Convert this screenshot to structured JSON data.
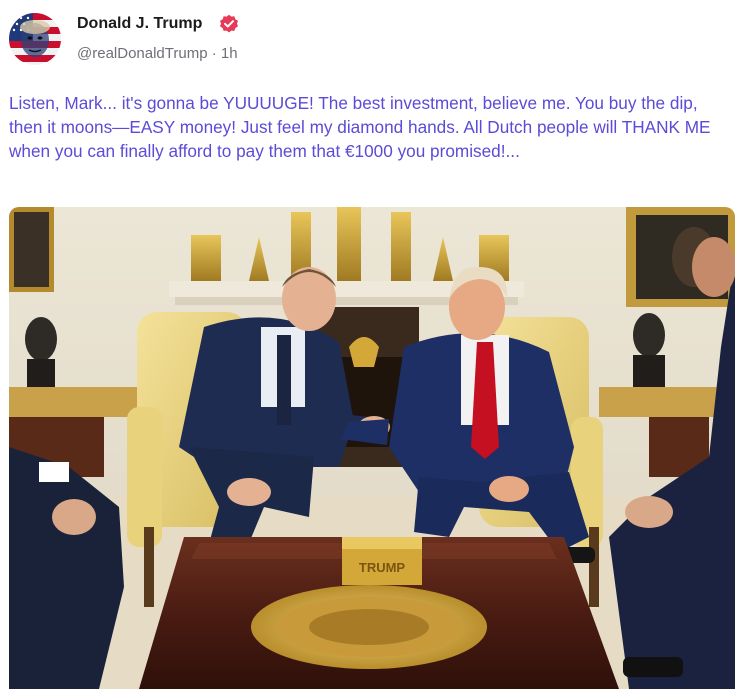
{
  "author": {
    "name": "Donald J. Trump",
    "handle": "@realDonaldTrump",
    "separator": " · ",
    "time_ago": "1h",
    "verified": true,
    "verified_color": "#e63a58"
  },
  "post": {
    "text": "Listen, Mark... it's gonna be YUUUUGE! The best investment, believe me. You buy the dip, then it moons—EASY money! Just feel my diamond hands. All Dutch people will THANK ME when you can finally afford to pay them that €1000 you promised!...",
    "text_color": "#5b4bd6"
  },
  "media": {
    "type": "photo",
    "box_lettering": "TRUMP"
  },
  "icons": {
    "verified": "verified-badge-icon",
    "avatar": "avatar-flag-portrait"
  }
}
